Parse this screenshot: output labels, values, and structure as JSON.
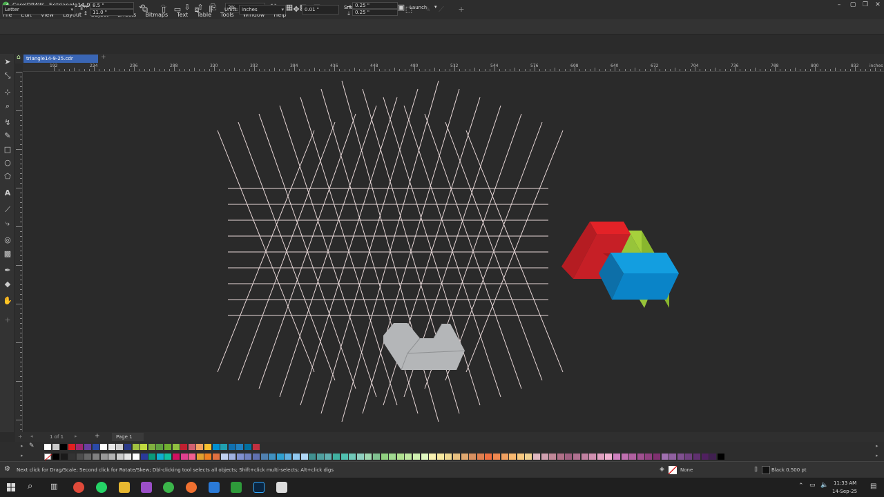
{
  "window": {
    "title": "CorelDRAW - E:\\triangle14-9-25.cdr"
  },
  "menu": [
    "File",
    "Edit",
    "View",
    "Layout",
    "Object",
    "Effects",
    "Bitmaps",
    "Text",
    "Table",
    "Tools",
    "Window",
    "Help"
  ],
  "toolbar": {
    "zoom_value": "3%",
    "snap_to_label": "Snap To",
    "launch_label": "Launch"
  },
  "property_bar": {
    "page_size": "Letter",
    "width": "8.5 \"",
    "height": "11.0 \"",
    "units_label": "Units:",
    "units_value": "inches",
    "nudge": "0.01 \"",
    "dup_x": "0.25 \"",
    "dup_y": "0.25 \""
  },
  "document_tab": "triangle14-9-25.cdr",
  "ruler": {
    "unit_label": "inches",
    "ticks": [
      "192",
      "224",
      "256",
      "288",
      "320",
      "352",
      "384",
      "416",
      "448",
      "480",
      "512",
      "544",
      "576",
      "608",
      "640",
      "672",
      "704",
      "736",
      "768",
      "800",
      "832"
    ]
  },
  "page_nav": {
    "count": "1 of 1",
    "page_tab": "Page 1"
  },
  "palette": {
    "row1": [
      "#ffffff",
      "#c8c8c8",
      "#000000",
      "#e02020",
      "#a02870",
      "#6a3fa0",
      "#2a4aa8",
      "#ffffff",
      "#e8e8e8",
      "#d0d0d0",
      "#2a3a8a",
      "#a0c040",
      "#c0d840",
      "#80b040",
      "#60a040",
      "#70b030",
      "#90c040",
      "#c02030",
      "#d06070",
      "#f0a060",
      "#f8c030",
      "#0090d0",
      "#20a0b0",
      "#1070b0",
      "#2080c0",
      "#0070a0",
      "#c03040"
    ],
    "row2": [
      "#000000",
      "#1a1a1a",
      "#333333",
      "#4d4d4d",
      "#666666",
      "#808080",
      "#999999",
      "#b3b3b3",
      "#cccccc",
      "#e6e6e6",
      "#ffffff",
      "#2a3a9a",
      "#0a9a7a",
      "#10b0d0",
      "#10c0a0",
      "#d01060",
      "#e04090",
      "#f06090",
      "#e0a030",
      "#f08020",
      "#e07040",
      "#c0d0f0",
      "#a0b0e0",
      "#8090d0",
      "#7080c0",
      "#6070b0",
      "#5080b0",
      "#4090c0",
      "#30a0d0",
      "#60b0e0",
      "#90c8f0",
      "#b0d8f8",
      "#409090",
      "#50a0a0",
      "#60b0b0",
      "#40b0a0",
      "#50c0b0",
      "#70c8b8",
      "#90d0c0",
      "#a0d8b0",
      "#80c090",
      "#90d080",
      "#a0d890",
      "#b0e090",
      "#c0e8a0",
      "#d0f0b0",
      "#e0f8c0",
      "#f8f0b0",
      "#f8e8a0",
      "#f0d890",
      "#e8c080",
      "#e0a870",
      "#d89060",
      "#e08050",
      "#f07040",
      "#f08850",
      "#f0a060",
      "#f8b870",
      "#f8c880",
      "#f0d090",
      "#e0b8c0",
      "#d0a0b0",
      "#c08898",
      "#b07088",
      "#a06080",
      "#b07090",
      "#c080a0",
      "#d090b0",
      "#e0a0c0",
      "#f0b0d0",
      "#d080c0",
      "#c070b0",
      "#b060a0",
      "#a05090",
      "#904080",
      "#803070",
      "#a070b0",
      "#9060a0",
      "#805090",
      "#704080",
      "#603070",
      "#502060",
      "#402050",
      "#000000"
    ]
  },
  "status": {
    "hint": "Next click for Drag/Scale; Second click for Rotate/Skew; Dbl-clicking tool selects all objects; Shift+click multi-selects; Alt+click digs",
    "fill_label": "None",
    "outline_label": "Black  0.500 pt"
  },
  "taskbar": {
    "time": "11:33 AM",
    "date": "14-Sep-25"
  },
  "colors": {
    "grid_line": "#e8d8d8",
    "logo_red": "#e32227",
    "logo_green": "#9bc53d",
    "logo_blue": "#0a8fd8",
    "shape_gray": "#b4b6b8",
    "accent": "#3a66b5"
  }
}
